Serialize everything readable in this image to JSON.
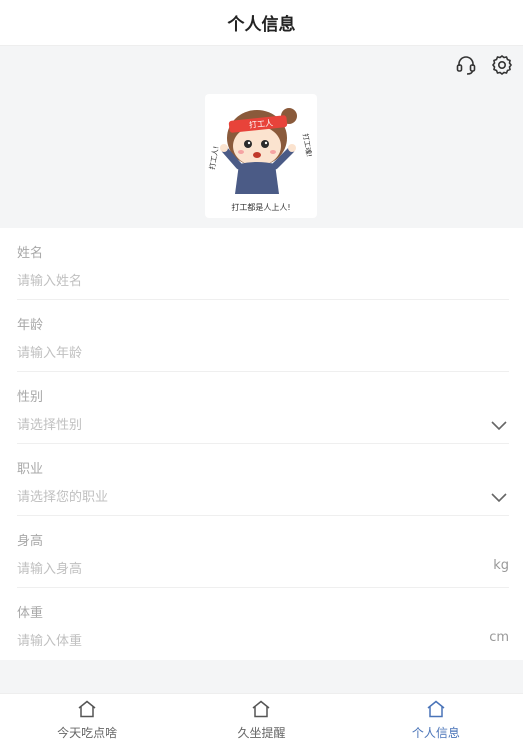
{
  "header": {
    "title": "个人信息"
  },
  "icons": {
    "support": "headset-icon",
    "settings": "gear-icon"
  },
  "avatar": {
    "headband_text": "打工人",
    "left_text": "打工人!",
    "right_text": "打工魂!",
    "caption": "打工都是人上人!"
  },
  "form": {
    "name": {
      "label": "姓名",
      "placeholder": "请输入姓名"
    },
    "age": {
      "label": "年龄",
      "placeholder": "请输入年龄"
    },
    "gender": {
      "label": "性别",
      "placeholder": "请选择性别"
    },
    "occupation": {
      "label": "职业",
      "placeholder": "请选择您的职业"
    },
    "height": {
      "label": "身高",
      "placeholder": "请输入身高",
      "unit": "kg"
    },
    "weight": {
      "label": "体重",
      "placeholder": "请输入体重",
      "unit": "cm"
    }
  },
  "tabbar": {
    "tabs": [
      {
        "label": "今天吃点啥"
      },
      {
        "label": "久坐提醒"
      },
      {
        "label": "个人信息"
      }
    ],
    "active_color": "#4a74b8",
    "inactive_color": "#666666"
  }
}
